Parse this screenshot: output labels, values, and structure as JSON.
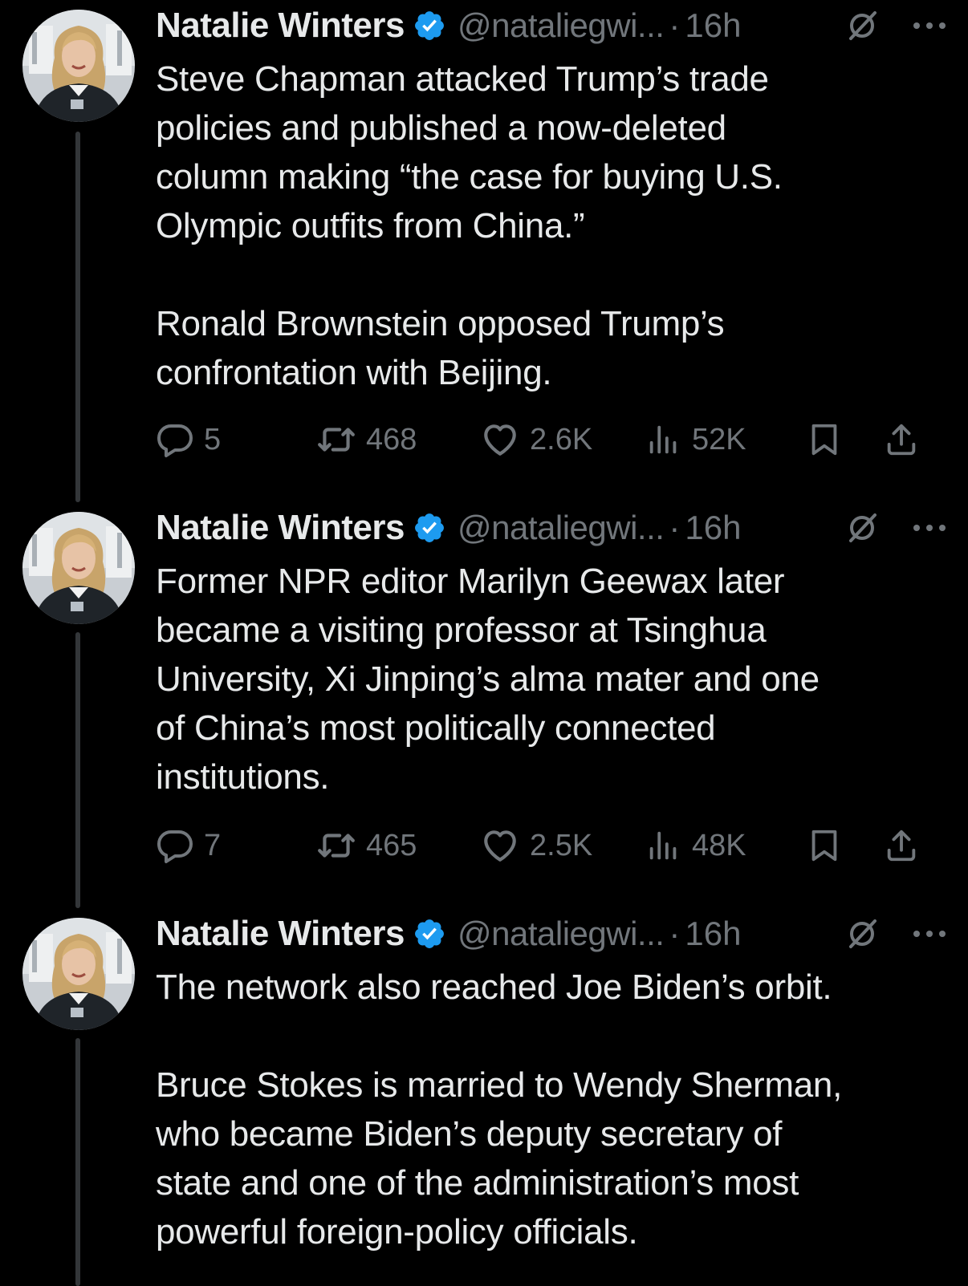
{
  "tweets": [
    {
      "author": {
        "name": "Natalie Winters",
        "handle": "@nataliegwi...",
        "verified": true
      },
      "separator": "·",
      "time": "16h",
      "text": "Steve Chapman attacked Trump’s trade\npolicies and published a now-deleted\ncolumn making “the case for buying U.S.\nOlympic outfits from China.”\n\nRonald Brownstein opposed Trump’s\nconfrontation with Beijing.",
      "stats": {
        "replies": "5",
        "reposts": "468",
        "likes": "2.6K",
        "views": "52K"
      }
    },
    {
      "author": {
        "name": "Natalie Winters",
        "handle": "@nataliegwi...",
        "verified": true
      },
      "separator": "·",
      "time": "16h",
      "text": "Former NPR editor Marilyn Geewax later\nbecame a visiting professor at Tsinghua\nUniversity, Xi Jinping’s alma mater and one\nof China’s most politically connected\ninstitutions.",
      "stats": {
        "replies": "7",
        "reposts": "465",
        "likes": "2.5K",
        "views": "48K"
      }
    },
    {
      "author": {
        "name": "Natalie Winters",
        "handle": "@nataliegwi...",
        "verified": true
      },
      "separator": "·",
      "time": "16h",
      "text": "The network also reached Joe Biden’s orbit.\n\nBruce Stokes is married to Wendy Sherman,\nwho became Biden’s deputy secretary of\nstate and one of the administration’s most\npowerful foreign-policy officials."
    }
  ],
  "colors": {
    "background": "#000000",
    "text": "#e7e9ea",
    "secondary": "#71767b",
    "verified": "#1d9bf0",
    "thread_line": "#333639"
  },
  "icons": {
    "verified": "verified-badge-icon",
    "grok": "grok-icon",
    "more": "more-horizontal-icon",
    "reply": "reply-icon",
    "repost": "repost-icon",
    "like": "heart-icon",
    "views": "views-icon",
    "bookmark": "bookmark-icon",
    "share": "share-icon"
  }
}
